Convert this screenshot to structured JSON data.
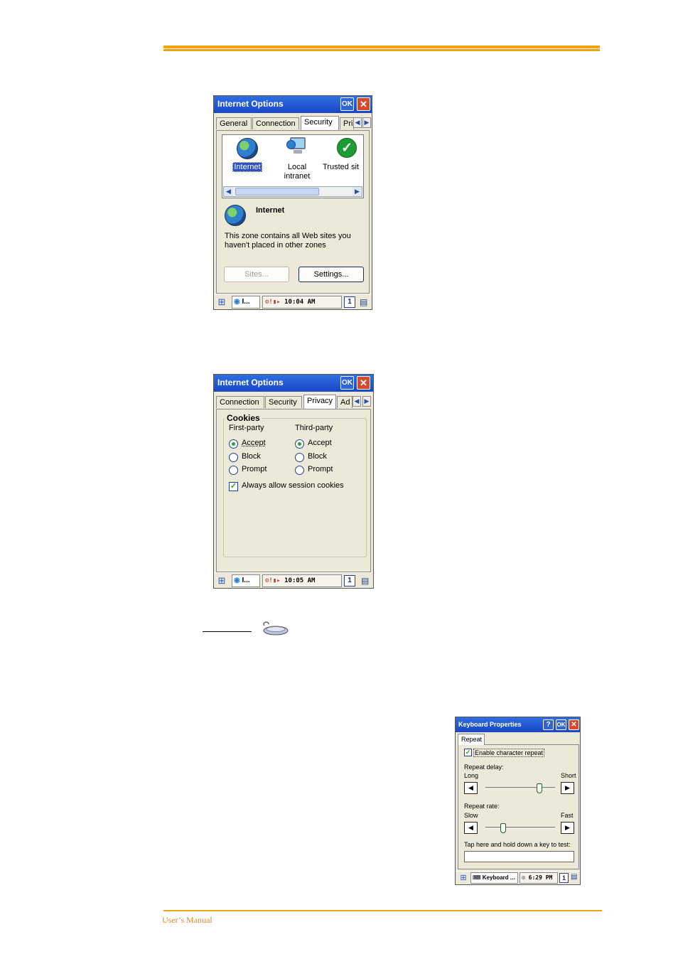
{
  "footer": {
    "text": "User’s Manual"
  },
  "shot1": {
    "title": "Internet Options",
    "ok": "OK",
    "close": "✕",
    "tabs": [
      "General",
      "Connection",
      "Security",
      "Pri"
    ],
    "selected_tab": "Security",
    "zones": [
      "Internet",
      "Local intranet",
      "Trusted sit"
    ],
    "zone_name": "Internet",
    "zone_desc": "This zone contains all Web sites you haven't placed in other zones",
    "sites_btn": "Sites...",
    "settings_btn": "Settings...",
    "task_label": "I...",
    "clock": "10:04 AM",
    "desk_num": "1"
  },
  "shot2": {
    "title": "Internet Options",
    "ok": "OK",
    "close": "✕",
    "tabs": [
      "Connection",
      "Security",
      "Privacy",
      "Ad"
    ],
    "selected_tab": "Privacy",
    "group": "Cookies",
    "first_party": "First-party",
    "third_party": "Third-party",
    "options": [
      "Accept",
      "Block",
      "Prompt"
    ],
    "first_selected": "Accept",
    "third_selected": "Accept",
    "session_cookies": "Always allow session cookies",
    "session_checked": true,
    "task_label": "I...",
    "clock": "10:05 AM",
    "desk_num": "1"
  },
  "shot3": {
    "title": "Keyboard Properties",
    "help": "?",
    "ok": "OK",
    "close": "✕",
    "tab": "Repeat",
    "enable_repeat": "Enable character repeat",
    "repeat_checked": true,
    "delay_label": "Repeat delay:",
    "delay_left": "Long",
    "delay_right": "Short",
    "delay_value": 0.78,
    "rate_label": "Repeat rate:",
    "rate_left": "Slow",
    "rate_right": "Fast",
    "rate_value": 0.25,
    "test_label": "Tap here and hold down a key to test:",
    "task_label": "Keyboard ...",
    "clock": "6:29 PM",
    "desk_num": "1"
  },
  "icons": {
    "start": "windows-start-icon",
    "keyboard": "keyboard-icon"
  }
}
